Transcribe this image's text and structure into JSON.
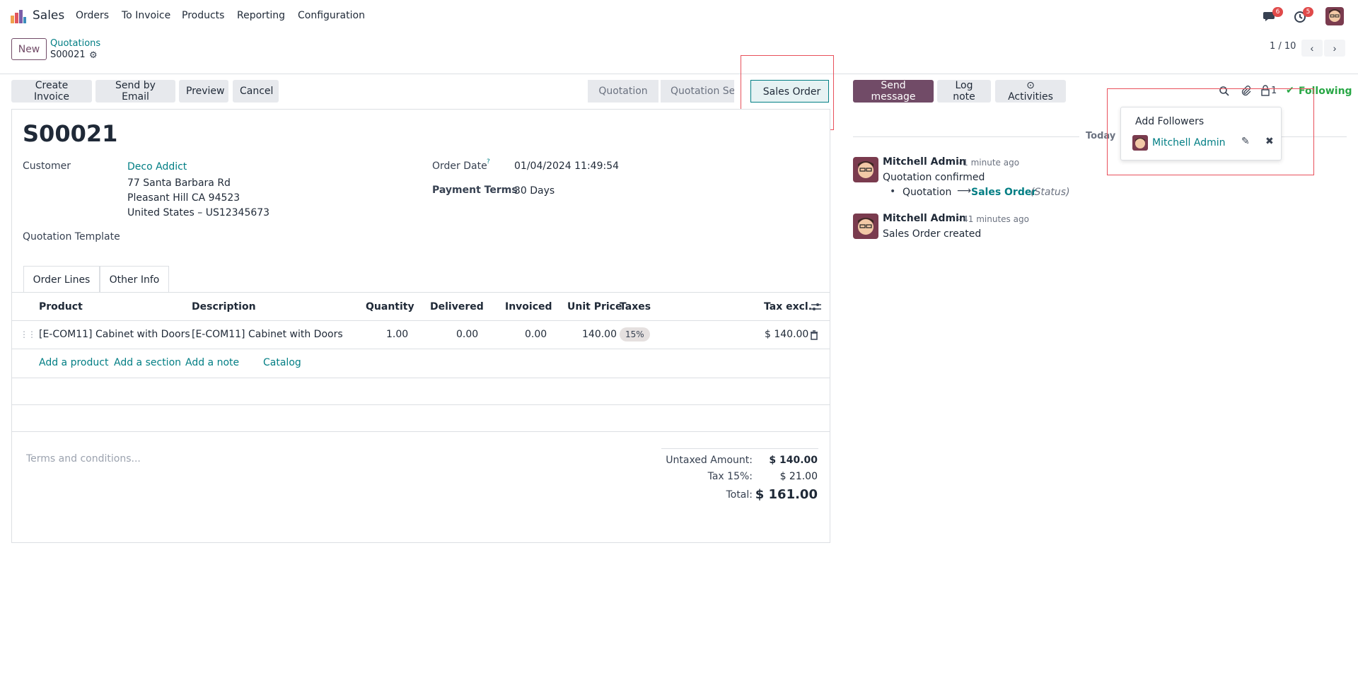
{
  "navbar": {
    "app_name": "Sales",
    "menu": [
      "Orders",
      "To Invoice",
      "Products",
      "Reporting",
      "Configuration"
    ],
    "messages_badge": "6",
    "activities_badge": "5"
  },
  "control_panel": {
    "new_label": "New",
    "breadcrumb_parent": "Quotations",
    "breadcrumb_current": "S00021",
    "pager": "1 / 10"
  },
  "actions": {
    "create_invoice": "Create Invoice",
    "send_by_email": "Send by Email",
    "preview": "Preview",
    "cancel": "Cancel"
  },
  "statusbar": {
    "stages": [
      "Quotation",
      "Quotation Sent",
      "Sales Order"
    ],
    "active": "Sales Order"
  },
  "form": {
    "title": "S00021",
    "customer_label": "Customer",
    "customer_name": "Deco Addict",
    "address_line1": "77 Santa Barbara Rd",
    "address_line2": "Pleasant Hill CA 94523",
    "address_line3": "United States – US12345673",
    "quotation_template_label": "Quotation Template",
    "order_date_label": "Order Date",
    "order_date_help": "?",
    "order_date": "01/04/2024 11:49:54",
    "payment_terms_label": "Payment Terms",
    "payment_terms": "30 Days"
  },
  "tabs": [
    "Order Lines",
    "Other Info"
  ],
  "order_lines": {
    "columns": [
      "Product",
      "Description",
      "Quantity",
      "Delivered",
      "Invoiced",
      "Unit Price",
      "Taxes",
      "Tax excl."
    ],
    "rows": [
      {
        "product": "[E-COM11] Cabinet with Doors",
        "description": "[E-COM11] Cabinet with Doors",
        "quantity": "1.00",
        "delivered": "0.00",
        "invoiced": "0.00",
        "unit_price": "140.00",
        "taxes": "15%",
        "subtotal": "$ 140.00"
      }
    ],
    "add_product": "Add a product",
    "add_section": "Add a section",
    "add_note": "Add a note",
    "catalog": "Catalog"
  },
  "footer": {
    "terms_placeholder": "Terms and conditions...",
    "untaxed_label": "Untaxed Amount:",
    "untaxed_value": "$ 140.00",
    "tax_label": "Tax 15%:",
    "tax_value": "$ 21.00",
    "total_label": "Total:",
    "total_value": "$ 161.00"
  },
  "chatter": {
    "send_message": "Send message",
    "log_note": "Log note",
    "activities": "Activities",
    "followers_count": "1",
    "following": "Following",
    "today": "Today",
    "messages": [
      {
        "author": "Mitchell Admin",
        "time": "- 1 minute ago",
        "body": "Quotation confirmed",
        "tracking_old": "Quotation",
        "tracking_new": "Sales Order",
        "tracking_field": "(Status)"
      },
      {
        "author": "Mitchell Admin",
        "time": "- 41 minutes ago",
        "body": "Sales Order created"
      }
    ],
    "followers_popup": {
      "add_followers": "Add Followers",
      "follower_name": "Mitchell Admin"
    }
  },
  "colors": {
    "brand": "#714b67",
    "link": "#017e84",
    "highlight": "#e8505b",
    "following": "#28a745"
  }
}
